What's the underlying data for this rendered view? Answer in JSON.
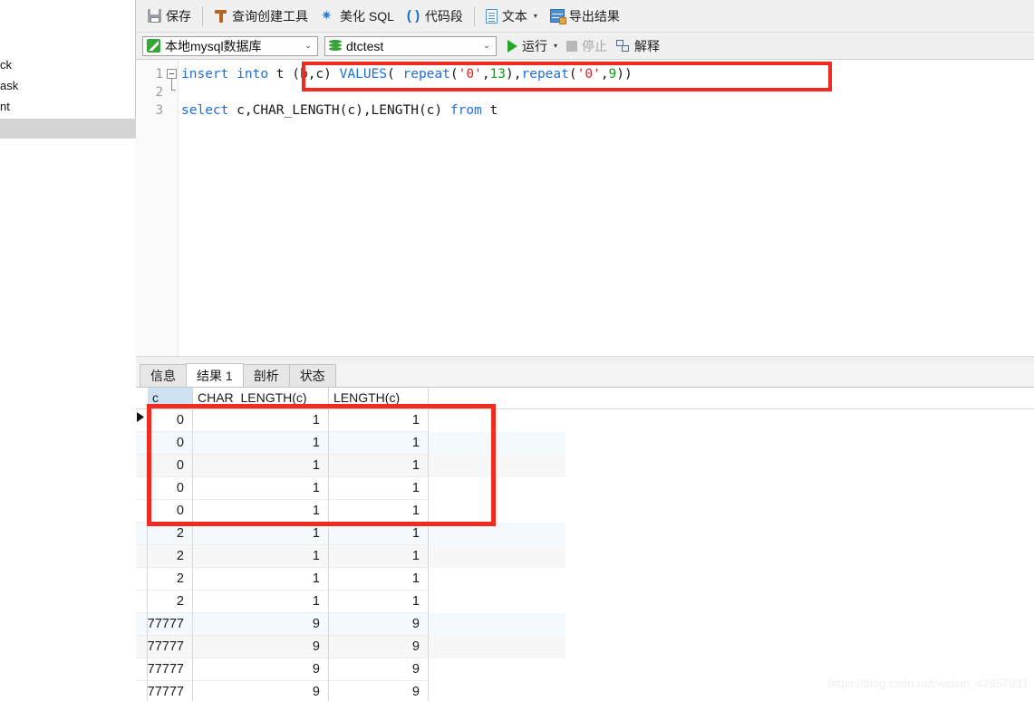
{
  "left_panel": {
    "fragments": [
      "ck",
      "ask",
      "nt"
    ]
  },
  "toolbar": {
    "items": [
      {
        "label": "保存",
        "icon": "save-icon",
        "caret": false
      },
      {
        "label": "查询创建工具",
        "icon": "query-builder-icon",
        "caret": false
      },
      {
        "label": "美化 SQL",
        "icon": "beautify-sparkle-icon",
        "caret": false
      },
      {
        "label": "代码段",
        "icon": "code-snippet-icon",
        "caret": false
      },
      {
        "label": "文本",
        "icon": "text-document-icon",
        "caret": true
      },
      {
        "label": "导出结果",
        "icon": "export-result-icon",
        "caret": false
      }
    ],
    "sparkle_glyph": "✷",
    "paren_glyph": "( )",
    "caret_glyph": "▾"
  },
  "connection_bar": {
    "connection": {
      "value": "本地mysql数据库",
      "icon": "connection-icon",
      "arrow": "⌄"
    },
    "database": {
      "value": "dtctest",
      "icon": "database-icon",
      "arrow": "⌄"
    },
    "run_label": "运行",
    "run_caret": "▾",
    "stop_label": "停止",
    "explain_label": "解释"
  },
  "editor": {
    "lines": [
      {
        "number": "1",
        "fold": true,
        "tokens": [
          {
            "t": "insert",
            "c": "kw"
          },
          {
            "t": " ",
            "c": "id"
          },
          {
            "t": "into",
            "c": "kw"
          },
          {
            "t": " t (b,c) ",
            "c": "id"
          },
          {
            "t": "VALUES",
            "c": "kw"
          },
          {
            "t": "( ",
            "c": "id"
          },
          {
            "t": "repeat",
            "c": "fn"
          },
          {
            "t": "(",
            "c": "id"
          },
          {
            "t": "'0'",
            "c": "str"
          },
          {
            "t": ",",
            "c": "id"
          },
          {
            "t": "13",
            "c": "num"
          },
          {
            "t": "),",
            "c": "id"
          },
          {
            "t": "repeat",
            "c": "fn"
          },
          {
            "t": "(",
            "c": "id"
          },
          {
            "t": "'0'",
            "c": "str"
          },
          {
            "t": ",",
            "c": "id"
          },
          {
            "t": "9",
            "c": "num"
          },
          {
            "t": "))",
            "c": "id"
          }
        ]
      },
      {
        "number": "2",
        "fold": false,
        "tokens": []
      },
      {
        "number": "3",
        "fold": false,
        "tokens": [
          {
            "t": "select",
            "c": "kw"
          },
          {
            "t": " c,",
            "c": "id"
          },
          {
            "t": "CHAR_LENGTH",
            "c": "id"
          },
          {
            "t": "(c),",
            "c": "id"
          },
          {
            "t": "LENGTH",
            "c": "id"
          },
          {
            "t": "(c) ",
            "c": "id"
          },
          {
            "t": "from",
            "c": "kw"
          },
          {
            "t": " t",
            "c": "id"
          }
        ]
      }
    ]
  },
  "result_tabs": [
    {
      "label": "信息",
      "active": false
    },
    {
      "label": "结果 1",
      "active": true
    },
    {
      "label": "剖析",
      "active": false
    },
    {
      "label": "状态",
      "active": false
    }
  ],
  "result_grid": {
    "columns": [
      "c",
      "CHAR_LENGTH(c)",
      "LENGTH(c)"
    ],
    "rows": [
      [
        "0",
        "1",
        "1"
      ],
      [
        "0",
        "1",
        "1"
      ],
      [
        "0",
        "1",
        "1"
      ],
      [
        "0",
        "1",
        "1"
      ],
      [
        "0",
        "1",
        "1"
      ],
      [
        "2",
        "1",
        "1"
      ],
      [
        "2",
        "1",
        "1"
      ],
      [
        "2",
        "1",
        "1"
      ],
      [
        "2",
        "1",
        "1"
      ],
      [
        "77777",
        "9",
        "9"
      ],
      [
        "77777",
        "9",
        "9"
      ],
      [
        "77777",
        "9",
        "9"
      ],
      [
        "77777",
        "9",
        "9"
      ]
    ]
  },
  "annotations": {
    "accent_color": "#f22b20",
    "editor_box": "highlight around insert statement",
    "grid_box": "highlight around first five result rows"
  },
  "watermark": {
    "text": "https://blog.csdn.net/weixin_42957931"
  }
}
